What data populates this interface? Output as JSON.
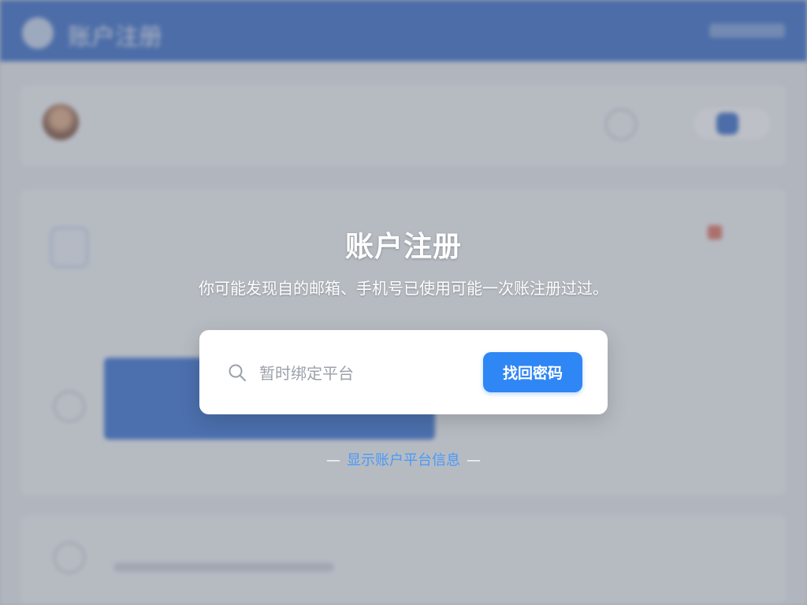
{
  "header": {
    "app_title": "账户注册"
  },
  "dialog": {
    "title": "账户注册",
    "subtitle": "你可能发现自的邮箱、手机号已使用可能一次账注册过过。",
    "search": {
      "placeholder": "暂时绑定平台",
      "value": ""
    },
    "recover_button_label": "找回密码",
    "info_link_label": "显示账户平台信息",
    "dash_left": "—",
    "dash_right": "—"
  },
  "icons": {
    "search": "search-icon"
  },
  "colors": {
    "header_blue": "#2f66c8",
    "button_blue": "#2f86f5",
    "link_blue": "#4a9af7"
  }
}
